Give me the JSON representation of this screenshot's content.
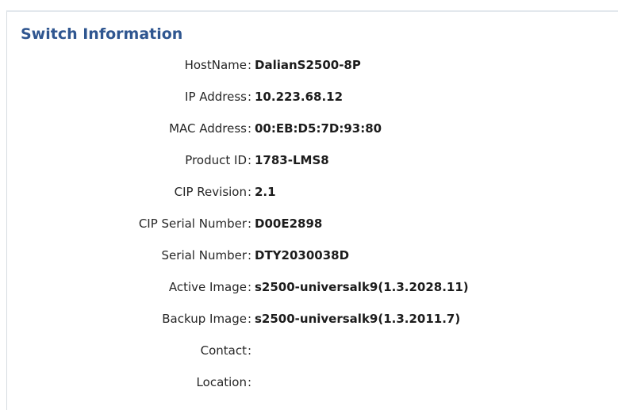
{
  "panel": {
    "title": "Switch Information"
  },
  "fields": [
    {
      "label": "HostName",
      "value": "DalianS2500-8P"
    },
    {
      "label": "IP Address",
      "value": "10.223.68.12"
    },
    {
      "label": "MAC Address",
      "value": "00:EB:D5:7D:93:80"
    },
    {
      "label": "Product ID",
      "value": "1783-LMS8"
    },
    {
      "label": "CIP Revision",
      "value": "2.1"
    },
    {
      "label": "CIP Serial Number",
      "value": "D00E2898"
    },
    {
      "label": "Serial Number",
      "value": "DTY2030038D"
    },
    {
      "label": "Active Image",
      "value": "s2500-universalk9(1.3.2028.11)"
    },
    {
      "label": "Backup Image",
      "value": "s2500-universalk9(1.3.2011.7)"
    },
    {
      "label": "Contact",
      "value": ""
    },
    {
      "label": "Location",
      "value": ""
    }
  ]
}
